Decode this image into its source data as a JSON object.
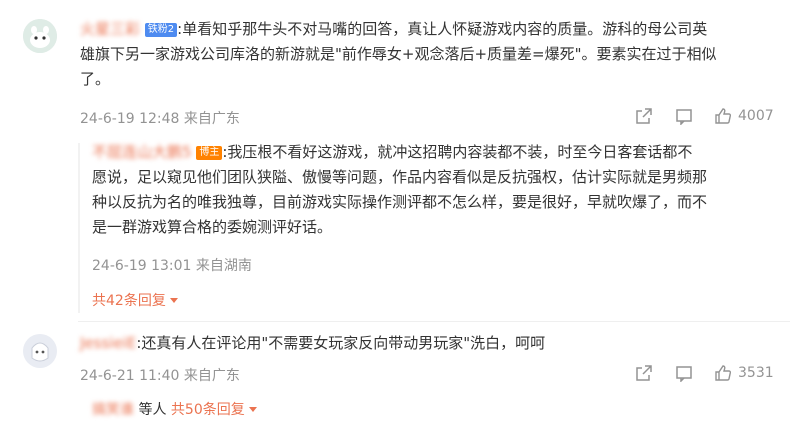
{
  "comment1": {
    "username": "火星三彩",
    "fan_badge": "铁粉2",
    "text_line1": ":单看知乎那牛头不对马嘴的回答，真让人怀疑游戏内容的质量。游科的母公司英",
    "text_line2": "雄旗下另一家游戏公司库洛的新游就是\"前作辱女+观念落后+质量差=爆死\"。要素实在过于相似",
    "text_line3": "了。",
    "meta": "24-6-19 12:48 来自广东",
    "like_count": "4007"
  },
  "reply1": {
    "username": "不屈连山大鹏5",
    "badge": "博主",
    "text_line1": ":我压根不看好这游戏，就冲这招聘内容装都不装，时至今日客套话都不",
    "text_line2": "愿说，足以窥见他们团队狭隘、傲慢等问题，作品内容看似是反抗强权，估计实际就是男频那",
    "text_line3": "种以反抗为名的唯我独尊，目前游戏实际操作测评都不怎么样，要是很好，早就吹爆了，而不",
    "text_line4": "是一群游戏算合格的委婉测评好话。",
    "meta": "24-6-19 13:01 来自湖南",
    "more_replies": "共42条回复"
  },
  "comment2": {
    "username": "JessieiE",
    "text": ":还真有人在评论用\"不需要女玩家反向带动男玩家\"洗白，呵呵",
    "meta": "24-6-21 11:40 来自广东",
    "like_count": "3531",
    "reply_user": "搞笑谁",
    "reply_etc": "等人",
    "more_replies": "共50条回复"
  },
  "colors": {
    "username": "#eb7350",
    "meta": "#939393",
    "fan_badge": "#4e8bf0",
    "blogger_badge": "#ff8200",
    "divider": "#efefef"
  }
}
